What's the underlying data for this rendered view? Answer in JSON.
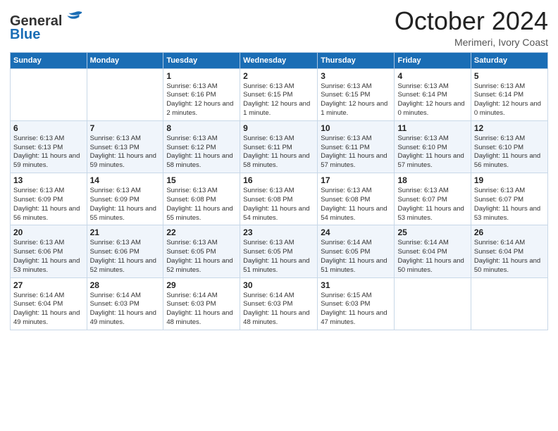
{
  "header": {
    "logo_general": "General",
    "logo_blue": "Blue",
    "month": "October 2024",
    "location": "Merimeri, Ivory Coast"
  },
  "days_of_week": [
    "Sunday",
    "Monday",
    "Tuesday",
    "Wednesday",
    "Thursday",
    "Friday",
    "Saturday"
  ],
  "weeks": [
    [
      null,
      null,
      {
        "day": 1,
        "sunrise": "Sunrise: 6:13 AM",
        "sunset": "Sunset: 6:16 PM",
        "daylight": "Daylight: 12 hours and 2 minutes."
      },
      {
        "day": 2,
        "sunrise": "Sunrise: 6:13 AM",
        "sunset": "Sunset: 6:15 PM",
        "daylight": "Daylight: 12 hours and 1 minute."
      },
      {
        "day": 3,
        "sunrise": "Sunrise: 6:13 AM",
        "sunset": "Sunset: 6:15 PM",
        "daylight": "Daylight: 12 hours and 1 minute."
      },
      {
        "day": 4,
        "sunrise": "Sunrise: 6:13 AM",
        "sunset": "Sunset: 6:14 PM",
        "daylight": "Daylight: 12 hours and 0 minutes."
      },
      {
        "day": 5,
        "sunrise": "Sunrise: 6:13 AM",
        "sunset": "Sunset: 6:14 PM",
        "daylight": "Daylight: 12 hours and 0 minutes."
      }
    ],
    [
      {
        "day": 6,
        "sunrise": "Sunrise: 6:13 AM",
        "sunset": "Sunset: 6:13 PM",
        "daylight": "Daylight: 11 hours and 59 minutes."
      },
      {
        "day": 7,
        "sunrise": "Sunrise: 6:13 AM",
        "sunset": "Sunset: 6:13 PM",
        "daylight": "Daylight: 11 hours and 59 minutes."
      },
      {
        "day": 8,
        "sunrise": "Sunrise: 6:13 AM",
        "sunset": "Sunset: 6:12 PM",
        "daylight": "Daylight: 11 hours and 58 minutes."
      },
      {
        "day": 9,
        "sunrise": "Sunrise: 6:13 AM",
        "sunset": "Sunset: 6:11 PM",
        "daylight": "Daylight: 11 hours and 58 minutes."
      },
      {
        "day": 10,
        "sunrise": "Sunrise: 6:13 AM",
        "sunset": "Sunset: 6:11 PM",
        "daylight": "Daylight: 11 hours and 57 minutes."
      },
      {
        "day": 11,
        "sunrise": "Sunrise: 6:13 AM",
        "sunset": "Sunset: 6:10 PM",
        "daylight": "Daylight: 11 hours and 57 minutes."
      },
      {
        "day": 12,
        "sunrise": "Sunrise: 6:13 AM",
        "sunset": "Sunset: 6:10 PM",
        "daylight": "Daylight: 11 hours and 56 minutes."
      }
    ],
    [
      {
        "day": 13,
        "sunrise": "Sunrise: 6:13 AM",
        "sunset": "Sunset: 6:09 PM",
        "daylight": "Daylight: 11 hours and 56 minutes."
      },
      {
        "day": 14,
        "sunrise": "Sunrise: 6:13 AM",
        "sunset": "Sunset: 6:09 PM",
        "daylight": "Daylight: 11 hours and 55 minutes."
      },
      {
        "day": 15,
        "sunrise": "Sunrise: 6:13 AM",
        "sunset": "Sunset: 6:08 PM",
        "daylight": "Daylight: 11 hours and 55 minutes."
      },
      {
        "day": 16,
        "sunrise": "Sunrise: 6:13 AM",
        "sunset": "Sunset: 6:08 PM",
        "daylight": "Daylight: 11 hours and 54 minutes."
      },
      {
        "day": 17,
        "sunrise": "Sunrise: 6:13 AM",
        "sunset": "Sunset: 6:08 PM",
        "daylight": "Daylight: 11 hours and 54 minutes."
      },
      {
        "day": 18,
        "sunrise": "Sunrise: 6:13 AM",
        "sunset": "Sunset: 6:07 PM",
        "daylight": "Daylight: 11 hours and 53 minutes."
      },
      {
        "day": 19,
        "sunrise": "Sunrise: 6:13 AM",
        "sunset": "Sunset: 6:07 PM",
        "daylight": "Daylight: 11 hours and 53 minutes."
      }
    ],
    [
      {
        "day": 20,
        "sunrise": "Sunrise: 6:13 AM",
        "sunset": "Sunset: 6:06 PM",
        "daylight": "Daylight: 11 hours and 53 minutes."
      },
      {
        "day": 21,
        "sunrise": "Sunrise: 6:13 AM",
        "sunset": "Sunset: 6:06 PM",
        "daylight": "Daylight: 11 hours and 52 minutes."
      },
      {
        "day": 22,
        "sunrise": "Sunrise: 6:13 AM",
        "sunset": "Sunset: 6:05 PM",
        "daylight": "Daylight: 11 hours and 52 minutes."
      },
      {
        "day": 23,
        "sunrise": "Sunrise: 6:13 AM",
        "sunset": "Sunset: 6:05 PM",
        "daylight": "Daylight: 11 hours and 51 minutes."
      },
      {
        "day": 24,
        "sunrise": "Sunrise: 6:14 AM",
        "sunset": "Sunset: 6:05 PM",
        "daylight": "Daylight: 11 hours and 51 minutes."
      },
      {
        "day": 25,
        "sunrise": "Sunrise: 6:14 AM",
        "sunset": "Sunset: 6:04 PM",
        "daylight": "Daylight: 11 hours and 50 minutes."
      },
      {
        "day": 26,
        "sunrise": "Sunrise: 6:14 AM",
        "sunset": "Sunset: 6:04 PM",
        "daylight": "Daylight: 11 hours and 50 minutes."
      }
    ],
    [
      {
        "day": 27,
        "sunrise": "Sunrise: 6:14 AM",
        "sunset": "Sunset: 6:04 PM",
        "daylight": "Daylight: 11 hours and 49 minutes."
      },
      {
        "day": 28,
        "sunrise": "Sunrise: 6:14 AM",
        "sunset": "Sunset: 6:03 PM",
        "daylight": "Daylight: 11 hours and 49 minutes."
      },
      {
        "day": 29,
        "sunrise": "Sunrise: 6:14 AM",
        "sunset": "Sunset: 6:03 PM",
        "daylight": "Daylight: 11 hours and 48 minutes."
      },
      {
        "day": 30,
        "sunrise": "Sunrise: 6:14 AM",
        "sunset": "Sunset: 6:03 PM",
        "daylight": "Daylight: 11 hours and 48 minutes."
      },
      {
        "day": 31,
        "sunrise": "Sunrise: 6:15 AM",
        "sunset": "Sunset: 6:03 PM",
        "daylight": "Daylight: 11 hours and 47 minutes."
      },
      null,
      null
    ]
  ]
}
